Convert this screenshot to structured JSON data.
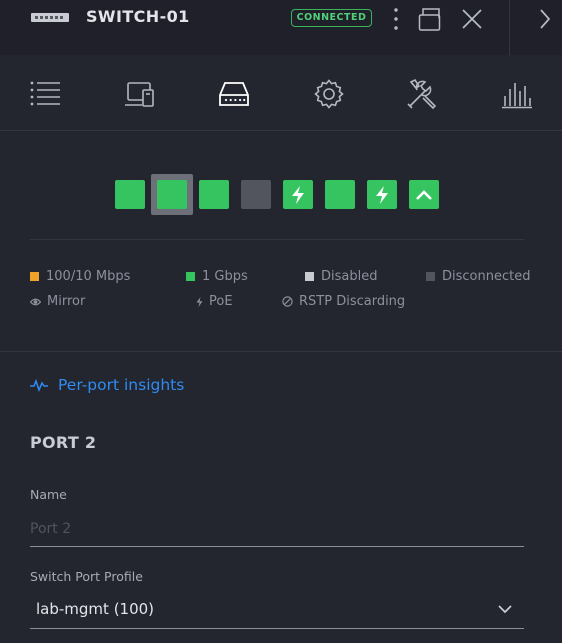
{
  "header": {
    "device_icon": "switch-device-icon",
    "title": "SWITCH-01",
    "status": "CONNECTED",
    "status_color": "#38b55b",
    "buttons": [
      "more-vertical-icon",
      "popout-window-icon",
      "close-icon",
      "chevron-right-icon"
    ]
  },
  "toolbar": {
    "tabs": [
      {
        "name": "list-icon",
        "active": false
      },
      {
        "name": "devices-icon",
        "active": false
      },
      {
        "name": "ports-icon",
        "active": true
      },
      {
        "name": "settings-gear-icon",
        "active": false
      },
      {
        "name": "tools-icon",
        "active": false
      },
      {
        "name": "statistics-icon",
        "active": false
      }
    ]
  },
  "ports": [
    {
      "number": 1,
      "state": "1 Gbps",
      "color": "#35c45f",
      "icon": null,
      "selected": false
    },
    {
      "number": 2,
      "state": "1 Gbps",
      "color": "#35c45f",
      "icon": null,
      "selected": true
    },
    {
      "number": 3,
      "state": "1 Gbps",
      "color": "#35c45f",
      "icon": null,
      "selected": false
    },
    {
      "number": 4,
      "state": "Disconnected",
      "color": "#52555d",
      "icon": null,
      "selected": false
    },
    {
      "number": 5,
      "state": "1 Gbps",
      "color": "#35c45f",
      "icon": "poe-bolt-icon",
      "selected": false
    },
    {
      "number": 6,
      "state": "1 Gbps",
      "color": "#35c45f",
      "icon": null,
      "selected": false
    },
    {
      "number": 7,
      "state": "1 Gbps",
      "color": "#35c45f",
      "icon": "poe-bolt-icon",
      "selected": false
    },
    {
      "number": 8,
      "state": "1 Gbps",
      "color": "#35c45f",
      "icon": "uplink-chevron-icon",
      "selected": false
    }
  ],
  "legend": {
    "speed_100_10": {
      "label": "100/10 Mbps",
      "color": "#f0a32b"
    },
    "speed_1g": {
      "label": "1 Gbps",
      "color": "#35c45f"
    },
    "disabled": {
      "label": "Disabled",
      "color": "#c8cad0"
    },
    "disconnected": {
      "label": "Disconnected",
      "color": "#52555d"
    },
    "mirror": {
      "label": "Mirror",
      "icon": "eye-icon"
    },
    "poe": {
      "label": "PoE",
      "icon": "bolt-icon"
    },
    "rstp": {
      "label": "RSTP Discarding",
      "icon": "blocked-icon"
    }
  },
  "insights": {
    "label": "Per-port insights",
    "icon": "pulse-icon",
    "color": "#2f8cf0"
  },
  "port_detail": {
    "title": "PORT 2",
    "name_label": "Name",
    "name_placeholder": "Port 2",
    "name_value": "",
    "profile_label": "Switch Port Profile",
    "profile_value": "lab-mgmt (100)"
  }
}
